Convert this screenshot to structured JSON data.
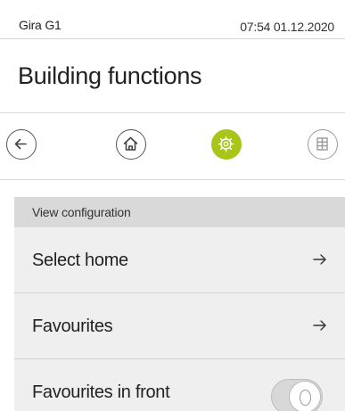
{
  "status_bar": {
    "device_name": "Gira G1",
    "clock": "07:54 01.12.2020"
  },
  "page": {
    "title": "Building functions"
  },
  "nav": {
    "items": [
      {
        "icon": "back-arrow-icon"
      },
      {
        "icon": "home-icon"
      },
      {
        "icon": "settings-gear-icon",
        "active": true
      },
      {
        "icon": "grid-icon"
      }
    ],
    "accent_color": "#a9c51a"
  },
  "section": {
    "header": "View configuration",
    "items": [
      {
        "label": "Select home",
        "control": "arrow-right-icon"
      },
      {
        "label": "Favourites",
        "control": "arrow-right-icon"
      },
      {
        "label": "Favourites in front",
        "control": "toggle",
        "toggle_on": false
      }
    ]
  }
}
